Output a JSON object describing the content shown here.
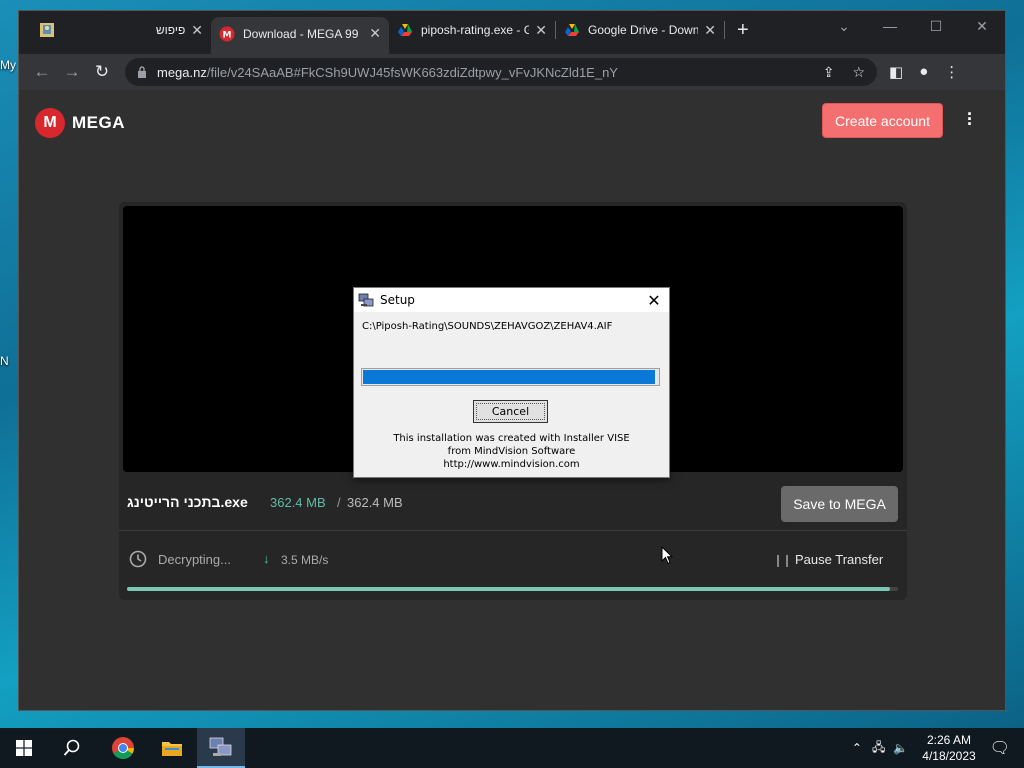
{
  "desktop": {
    "labels": [
      "My",
      "N"
    ]
  },
  "browser": {
    "tabs": [
      {
        "title": "פיפוש",
        "favicon": "app-icon",
        "active": false
      },
      {
        "title": "Download - MEGA 99",
        "favicon": "mega-icon",
        "active": true
      },
      {
        "title": "piposh-rating.exe - G",
        "favicon": "google-drive-icon",
        "active": false
      },
      {
        "title": "Google Drive - Down",
        "favicon": "google-drive-icon",
        "active": false
      }
    ],
    "url_domain": "mega.nz",
    "url_path": "/file/v24SAaAB#FkCSh9UWJ45fsWK663zdiZdtpwy_vFvJKNcZld1E_nY"
  },
  "mega": {
    "logo_text": "MEGA",
    "create_account": "Create account",
    "file_name": "בתכני הרייטינג.exe",
    "size_done": "362.4 MB",
    "size_sep": "/",
    "size_total": "362.4 MB",
    "save_label": "Save to MEGA",
    "status": "Decrypting...",
    "speed": "3.5 MB/s",
    "pause_label": "Pause Transfer",
    "progress_percent": 99
  },
  "setup": {
    "title": "Setup",
    "path": "C:\\Piposh-Rating\\SOUNDS\\ZEHAVGOZ\\ZEHAV4.AIF",
    "progress_percent": 99,
    "cancel_label": "Cancel",
    "info_line1": "This installation was created with Installer VISE",
    "info_line2": "from MindVision Software",
    "info_line3": "http://www.mindvision.com"
  },
  "taskbar": {
    "time": "2:26 AM",
    "date": "4/18/2023"
  },
  "colors": {
    "mega_red": "#d9272e",
    "create_account_bg": "#f46f6f",
    "mega_teal": "#5dbba6",
    "setup_progress": "#0a78d7"
  }
}
